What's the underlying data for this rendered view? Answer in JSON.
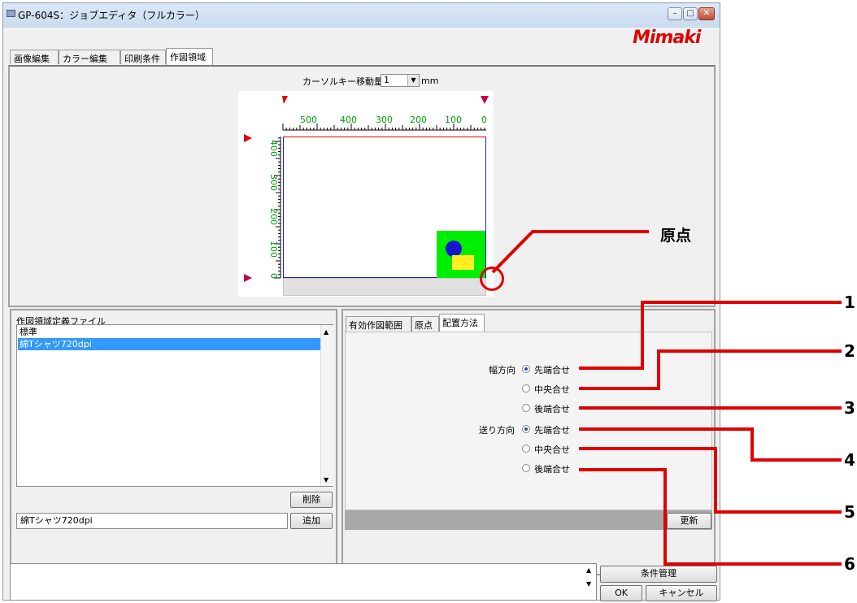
{
  "window": {
    "title": "GP-604S：ジョブエディタ（フルカラー）",
    "logo": "Mimaki",
    "caption_buttons": [
      "–",
      "□",
      "✕"
    ]
  },
  "tabs": [
    {
      "label": "画像編集",
      "selected": false
    },
    {
      "label": "カラー編集",
      "selected": false
    },
    {
      "label": "印刷条件",
      "selected": false
    },
    {
      "label": "作図領域",
      "selected": true
    }
  ],
  "canvas": {
    "cursor_move_label": "カーソルキー移動量",
    "cursor_move_value": "1",
    "cursor_move_unit": "mm",
    "x_ticks": [
      "500",
      "400",
      "300",
      "200",
      "100",
      "0"
    ],
    "y_ticks": [
      "400",
      "300",
      "200",
      "100",
      "0"
    ],
    "origin_label": "原点"
  },
  "file_panel": {
    "title": "作図領域定義ファイル",
    "items": [
      {
        "label": "標準",
        "selected": false
      },
      {
        "label": "綿Tシャツ720dpi",
        "selected": true
      }
    ],
    "delete_button": "削除",
    "file_name_value": "綿Tシャツ720dpi",
    "add_button": "追加"
  },
  "right_panel": {
    "tabs": [
      {
        "label": "有効作図範囲",
        "selected": false
      },
      {
        "label": "原点",
        "selected": false
      },
      {
        "label": "配置方法",
        "selected": true
      }
    ],
    "width_direction_label": "幅方向",
    "width_options": [
      {
        "label": "先端合せ",
        "checked": true
      },
      {
        "label": "中央合せ",
        "checked": false
      },
      {
        "label": "後端合せ",
        "checked": false
      }
    ],
    "feed_direction_label": "送り方向",
    "feed_options": [
      {
        "label": "先端合せ",
        "checked": true
      },
      {
        "label": "中央合せ",
        "checked": false
      },
      {
        "label": "後端合せ",
        "checked": false
      }
    ],
    "update_button": "更新"
  },
  "footer": {
    "condition_button": "条件管理",
    "ok_button": "OK",
    "cancel_button": "キャンセル"
  },
  "callouts": [
    "1",
    "2",
    "3",
    "4",
    "5",
    "6"
  ],
  "colors": {
    "accent_red": "#e00000",
    "selection_blue": "#3399ff",
    "ruler_green": "#00a000"
  }
}
